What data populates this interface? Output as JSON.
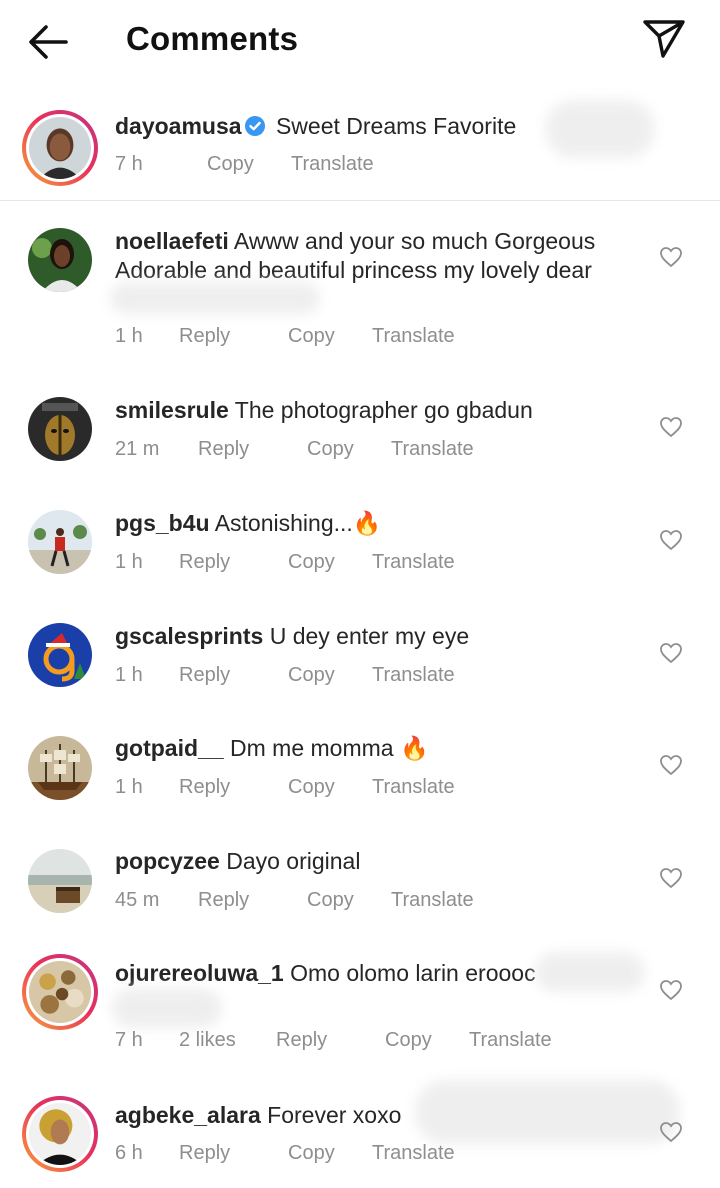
{
  "header": {
    "title": "Comments",
    "back_icon": "arrow-left-icon",
    "send_icon": "paper-plane-icon"
  },
  "caption": {
    "username": "dayoamusa",
    "verified": true,
    "text": "Sweet Dreams Favorite",
    "time": "7 h",
    "copy": "Copy",
    "translate": "Translate"
  },
  "comments": [
    {
      "username": "noellaefeti",
      "text_line1": "Awww and your so much Gorgeous",
      "text_line2": "Adorable and beautiful princess my lovely dear",
      "time": "1 h",
      "reply": "Reply",
      "copy": "Copy",
      "translate": "Translate"
    },
    {
      "username": "smilesrule",
      "text": "The photographer go gbadun",
      "time": "21 m",
      "reply": "Reply",
      "copy": "Copy",
      "translate": "Translate"
    },
    {
      "username": "pgs_b4u",
      "text": "Astonishing...",
      "emoji": "🔥",
      "time": "1 h",
      "reply": "Reply",
      "copy": "Copy",
      "translate": "Translate"
    },
    {
      "username": "gscalesprints",
      "text": "U dey enter my eye",
      "time": "1 h",
      "reply": "Reply",
      "copy": "Copy",
      "translate": "Translate"
    },
    {
      "username": "gotpaid__",
      "text": "Dm me momma",
      "emoji": "🔥",
      "time": "1 h",
      "reply": "Reply",
      "copy": "Copy",
      "translate": "Translate"
    },
    {
      "username": "popcyzee",
      "text": "Dayo original",
      "time": "45 m",
      "reply": "Reply",
      "copy": "Copy",
      "translate": "Translate"
    },
    {
      "username": "ojurereoluwa_1",
      "text": "Omo olomo larin eroooc",
      "time": "7 h",
      "likes": "2 likes",
      "reply": "Reply",
      "copy": "Copy",
      "translate": "Translate"
    },
    {
      "username": "agbeke_alara",
      "text": "Forever xoxo",
      "time": "6 h",
      "reply": "Reply",
      "copy": "Copy",
      "translate": "Translate"
    }
  ],
  "colors": {
    "text": "#262626",
    "meta": "#8e8e8e",
    "verified": "#3897f0",
    "story_ring_start": "#f9a33a",
    "story_ring_end": "#c13584",
    "fire": "#ff6a00"
  }
}
